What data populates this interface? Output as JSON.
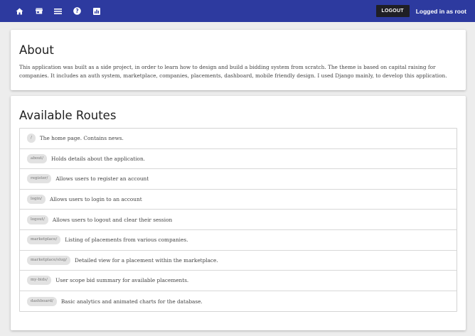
{
  "navbar": {
    "icons": [
      "home-icon",
      "storefront-icon",
      "menu-icon",
      "help-icon",
      "dashboard-icon"
    ],
    "logout_label": "LOGOUT",
    "user_text": "Logged in as root",
    "background": "#2d3a9f"
  },
  "about": {
    "title": "About",
    "text": "This application was built as a side project, in order to learn how to design and build a bidding system from scratch. The theme is based on capital raising for companies. It includes an auth system, marketplace, companies, placements, dashboard, mobile friendly design. I used Django mainly, to develop this application."
  },
  "routes": {
    "title": "Available Routes",
    "items": [
      {
        "path": "/",
        "description": "The home page. Contains news."
      },
      {
        "path": "about/",
        "description": "Holds details about the application."
      },
      {
        "path": "register/",
        "description": "Allows users to register an account"
      },
      {
        "path": "login/",
        "description": "Allows users to login to an account"
      },
      {
        "path": "logout/",
        "description": "Allows users to logout and clear their session"
      },
      {
        "path": "marketplace/",
        "description": "Listing of placements from various companies."
      },
      {
        "path": "marketplace/slug/",
        "description": "Detailed view for a placement within the marketplace."
      },
      {
        "path": "my-bids/",
        "description": "User scope bid summary for available placements."
      },
      {
        "path": "dashboard/",
        "description": "Basic analytics and animated charts for the database."
      }
    ]
  }
}
